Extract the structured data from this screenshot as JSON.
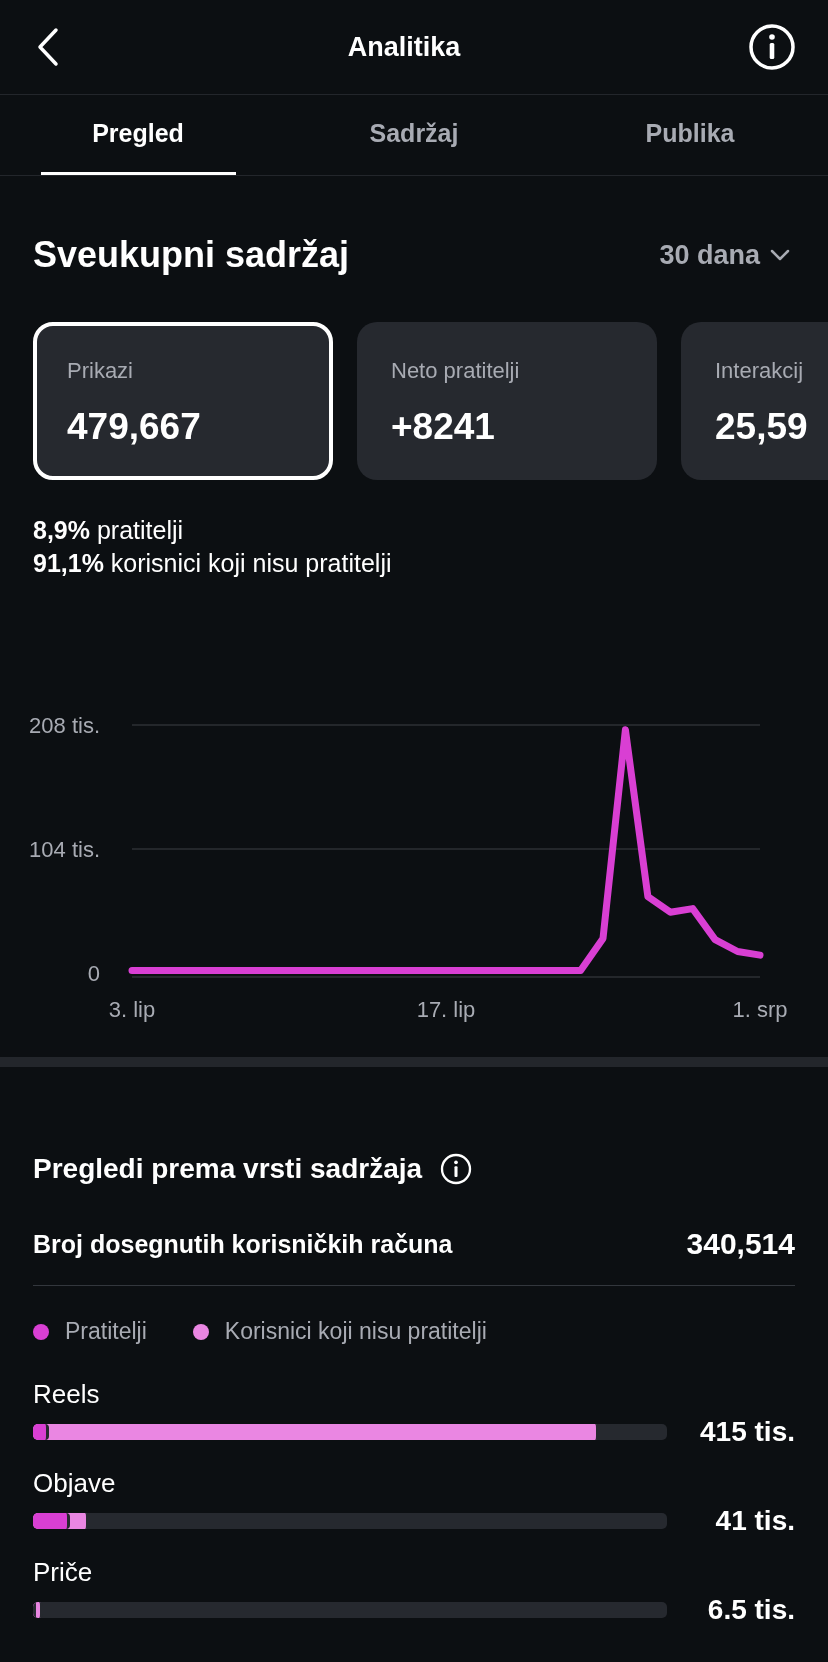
{
  "header": {
    "title": "Analitika"
  },
  "tabs": [
    {
      "label": "Pregled",
      "selected": true
    },
    {
      "label": "Sadržaj",
      "selected": false
    },
    {
      "label": "Publika",
      "selected": false
    }
  ],
  "overview": {
    "title": "Sveukupni sadržaj",
    "period": "30 dana",
    "cards": [
      {
        "label": "Prikazi",
        "value": "479,667",
        "selected": true
      },
      {
        "label": "Neto pratitelji",
        "value": "+8241",
        "selected": false
      },
      {
        "label": "Interakcij",
        "value": "25,59",
        "selected": false
      }
    ],
    "breakdown": [
      "**8,9%** pratitelji",
      "**91,1%** korisnici koji nisu pratitelji"
    ],
    "chart_data": {
      "type": "line",
      "categories": [
        "3. lip",
        null,
        null,
        null,
        null,
        null,
        null,
        null,
        null,
        null,
        null,
        null,
        null,
        null,
        "17. lip",
        null,
        null,
        null,
        null,
        null,
        null,
        null,
        null,
        null,
        null,
        null,
        null,
        null,
        "1. srp"
      ],
      "series": [
        {
          "color": "#d93fd3",
          "values": [
            2,
            2,
            2,
            2,
            2,
            2,
            2,
            2,
            2,
            2,
            2,
            2,
            2,
            2,
            2,
            2,
            2,
            2,
            2,
            2,
            2,
            29,
            204,
            64,
            51,
            54,
            28,
            18,
            15
          ]
        }
      ],
      "ylim": [
        0,
        208
      ],
      "yticks": [
        {
          "value": 0,
          "label": "0"
        },
        {
          "value": 104,
          "label": "104 tis."
        },
        {
          "value": 208,
          "label": "208 tis."
        }
      ]
    }
  },
  "content_types": {
    "title": "Pregledi prema vrsti sadržaja",
    "reach": {
      "label": "Broj dosegnutih korisničkih računa",
      "value": "340,514"
    },
    "legend": [
      {
        "label": "Pratitelji",
        "color": "#d93fd3"
      },
      {
        "label": "Korisnici koji nisu pratitelji",
        "color": "#ea86e2"
      }
    ],
    "rows": [
      {
        "label": "Reels",
        "value": "415 tis.",
        "segments": [
          {
            "level": 0.026
          },
          {
            "level": 0.893
          }
        ]
      },
      {
        "label": "Objave",
        "value": "41 tis.",
        "segments": [
          {
            "level": 0.059
          },
          {
            "level": 0.088
          }
        ]
      },
      {
        "label": "Priče",
        "value": "6.5 tis.",
        "segments": [
          {
            "level": 0.005
          },
          {
            "level": 0.016
          }
        ]
      }
    ]
  }
}
